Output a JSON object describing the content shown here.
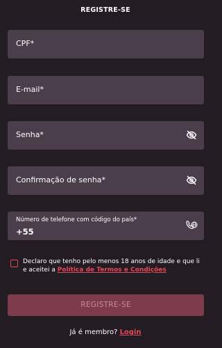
{
  "header": {
    "title": "REGISTRE-SE"
  },
  "form": {
    "cpf_label": "CPF*",
    "email_label": "E-mail*",
    "password_label": "Senha*",
    "confirm_password_label": "Confirmação de senha*",
    "phone_label": "Número de telefone com código do país*",
    "phone_value": "+55"
  },
  "terms": {
    "text": "Declaro que tenho pelo menos 18 anos de idade e que li e aceitei a ",
    "link": "Política de Termos e Condições"
  },
  "submit_label": "REGISTRE-SE",
  "footer": {
    "member_text": "Já é membro?",
    "login_link": "Login"
  },
  "colors": {
    "background": "#231c22",
    "field": "#4a3e4b",
    "accent": "#e24a5c",
    "button": "#7e3b4b"
  },
  "icons": [
    "eye-slash-icon",
    "phone-globe-icon"
  ]
}
